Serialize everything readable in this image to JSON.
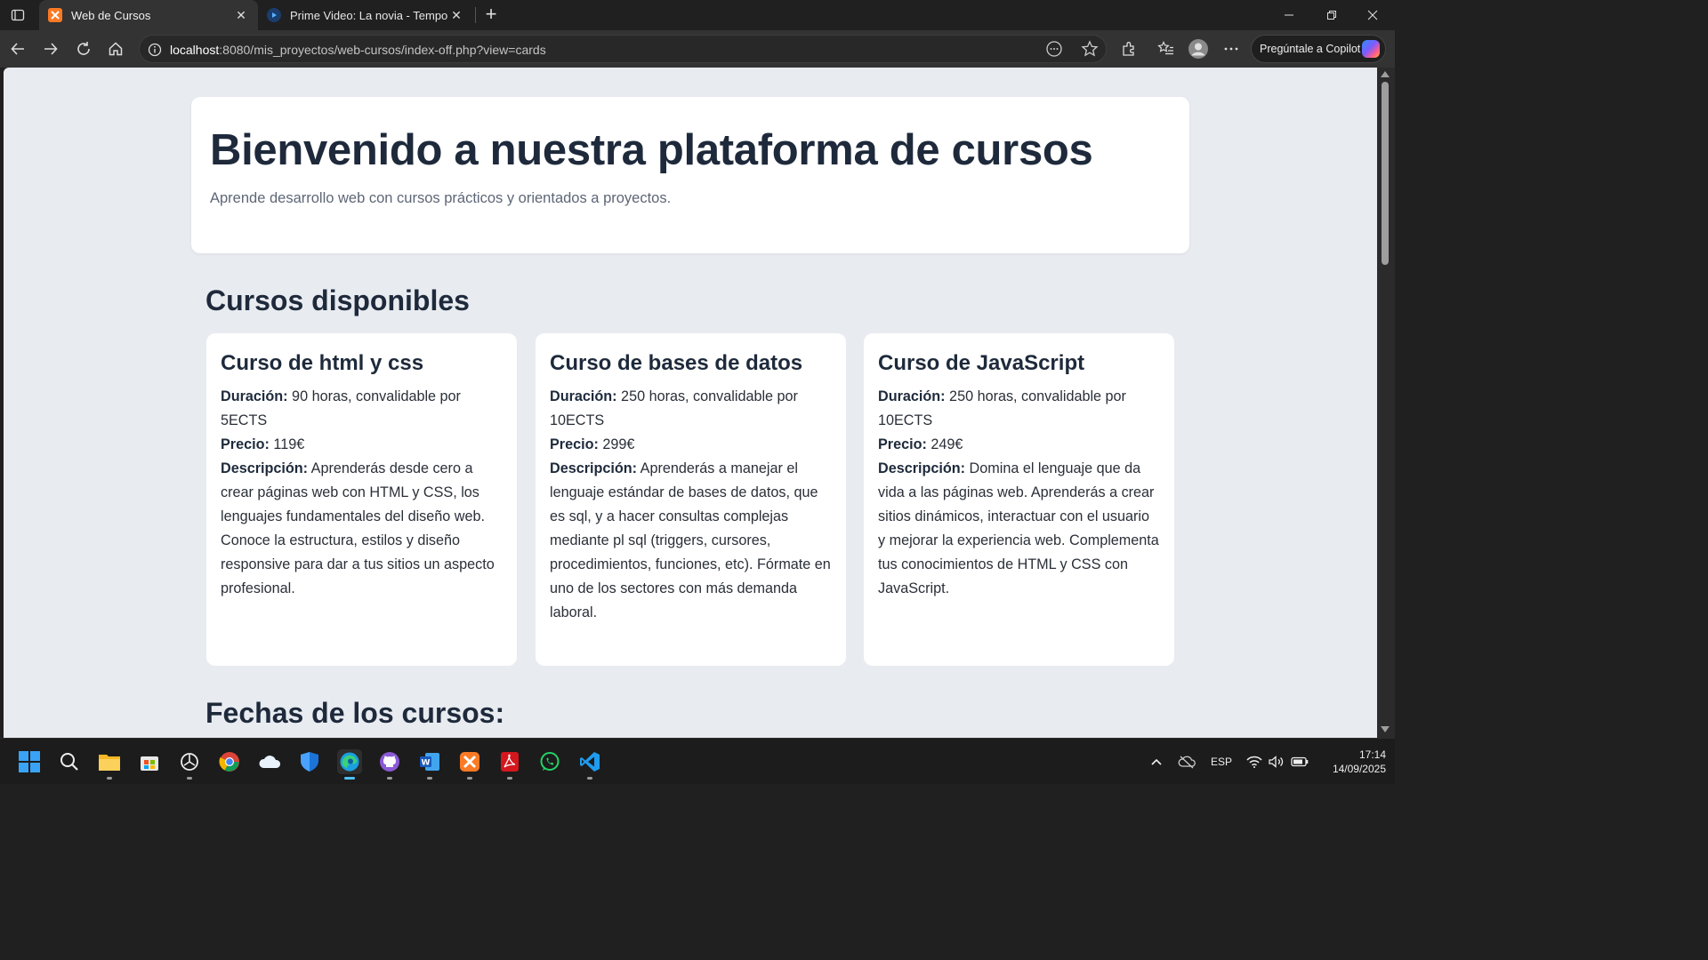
{
  "browser": {
    "tabs": [
      {
        "title": "Web de Cursos",
        "favicon": "xampp-icon",
        "active": true
      },
      {
        "title": "Prime Video: La novia - Temporada",
        "favicon": "prime-video-icon",
        "active": false
      }
    ],
    "address": {
      "host": "localhost",
      "path": ":8080/mis_proyectos/web-cursos/index-off.php?view=cards"
    },
    "copilot_label": "Pregúntale a Copilot"
  },
  "page": {
    "hero": {
      "title": "Bienvenido a nuestra plataforma de cursos",
      "subtitle": "Aprende desarrollo web con cursos prácticos y orientados a proyectos."
    },
    "courses_heading": "Cursos disponibles",
    "courses": [
      {
        "title": "Curso de html y css",
        "duration_label": "Duración:",
        "duration": " 90 horas, convalidable por 5ECTS",
        "price_label": "Precio:",
        "price": " 119€",
        "desc_label": "Descripción:",
        "desc": " Aprenderás desde cero a crear páginas web con HTML y CSS, los lenguajes fundamentales del diseño web. Conoce la estructura, estilos y diseño responsive para dar a tus sitios un aspecto profesional."
      },
      {
        "title": "Curso de bases de datos",
        "duration_label": "Duración:",
        "duration": " 250 horas, convalidable por 10ECTS",
        "price_label": "Precio:",
        "price": " 299€",
        "desc_label": "Descripción:",
        "desc": " Aprenderás a manejar el lenguaje estándar de bases de datos, que es sql, y a hacer consultas complejas mediante pl sql (triggers, cursores, procedimientos, funciones, etc). Fórmate en uno de los sectores con más demanda laboral."
      },
      {
        "title": "Curso de JavaScript",
        "duration_label": "Duración:",
        "duration": " 250 horas, convalidable por 10ECTS",
        "price_label": "Precio:",
        "price": " 249€",
        "desc_label": "Descripción:",
        "desc": " Domina el lenguaje que da vida a las páginas web. Aprenderás a crear sitios dinámicos, interactuar con el usuario y mejorar la experiencia web. Complementa tus conocimientos de HTML y CSS con JavaScript."
      }
    ],
    "dates_heading": "Fechas de los cursos:"
  },
  "taskbar": {
    "apps": [
      "start-icon",
      "search-icon",
      "file-explorer-icon",
      "microsoft-store-icon",
      "chatgpt-icon",
      "chrome-icon",
      "onedrive-icon",
      "defender-icon",
      "edge-icon",
      "github-desktop-icon",
      "word-icon",
      "xampp-icon",
      "acrobat-icon",
      "whatsapp-icon",
      "vscode-icon"
    ],
    "language": "ESP",
    "time": "17:14",
    "date": "14/09/2025"
  },
  "colors": {
    "page_bg": "#e8ebf0",
    "heading": "#1e2a3b",
    "card_bg": "#ffffff"
  }
}
